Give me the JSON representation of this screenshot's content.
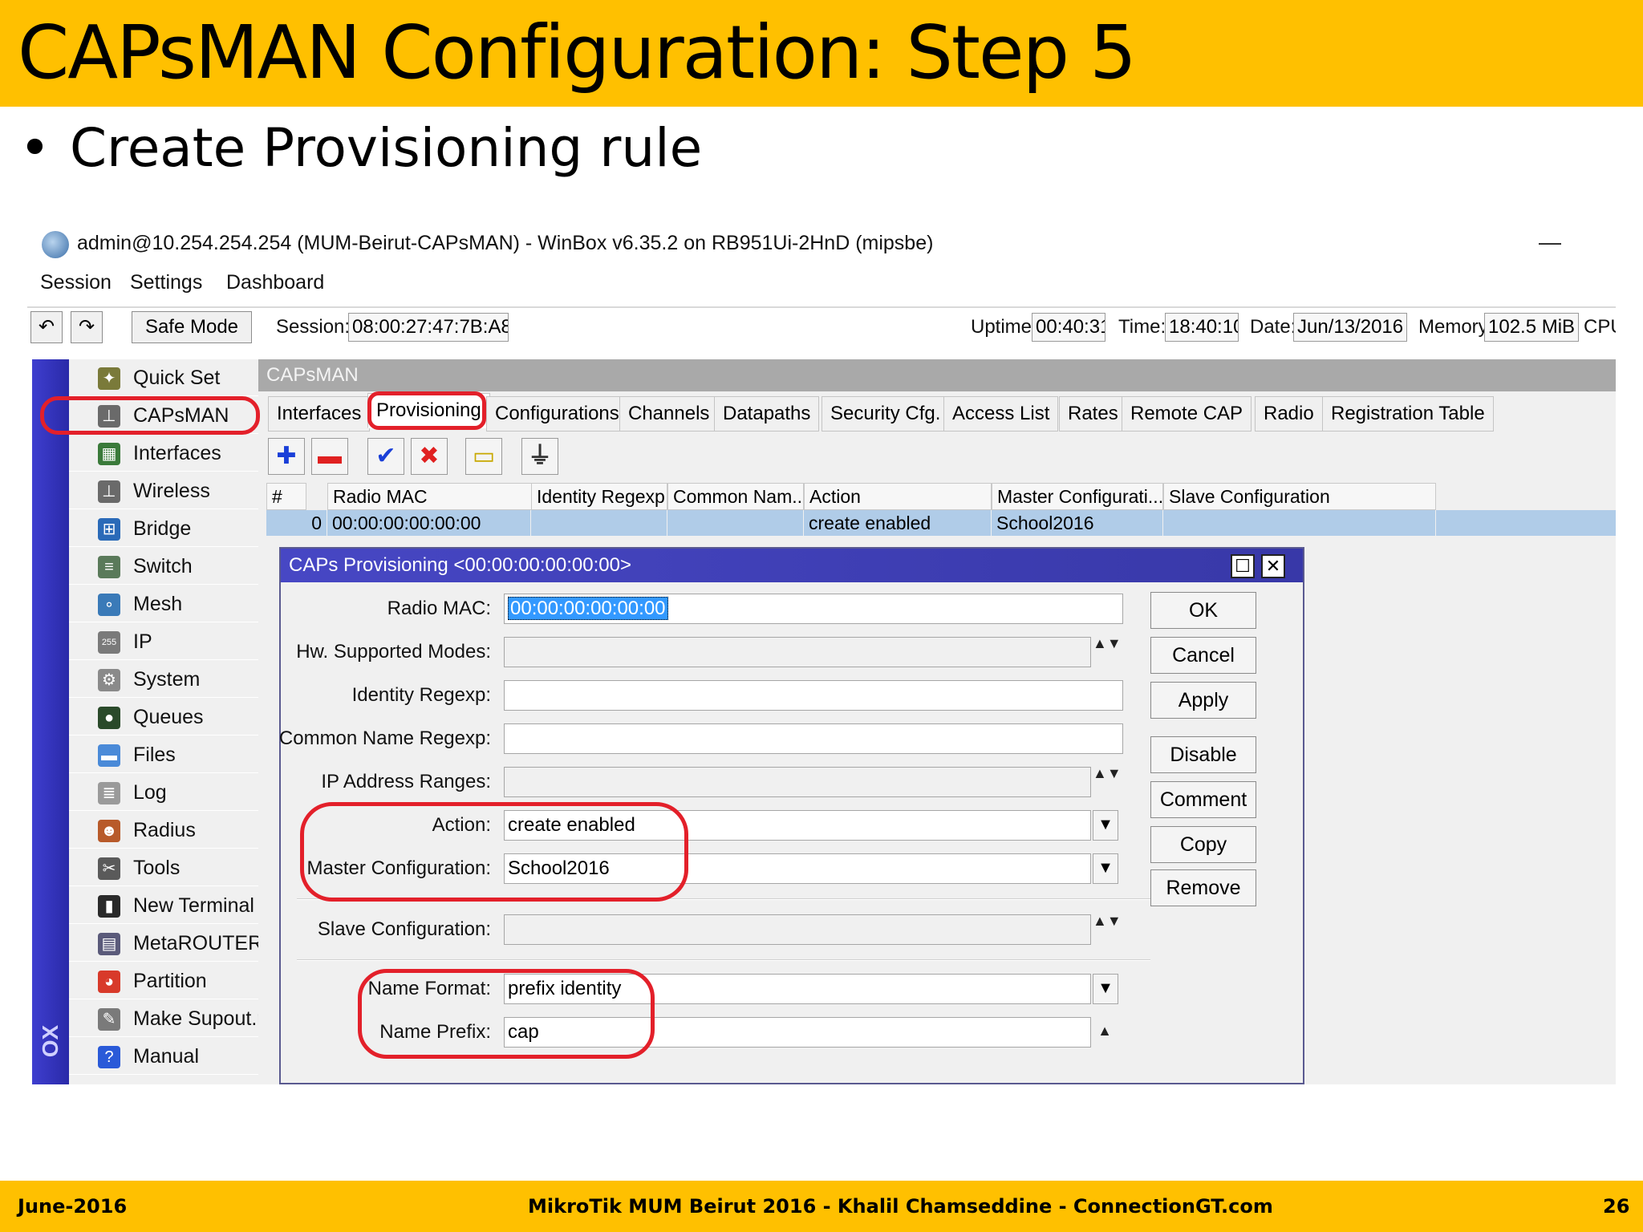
{
  "slide": {
    "title": "CAPsMAN Configuration: Step 5",
    "bullet": "Create Provisioning rule",
    "footer_left": "June-2016",
    "footer_center": "MikroTik MUM Beirut 2016 - Khalil Chamseddine - ConnectionGT.com",
    "footer_right": "26"
  },
  "window": {
    "title": "admin@10.254.254.254 (MUM-Beirut-CAPsMAN) - WinBox v6.35.2 on RB951Ui-2HnD (mipsbe)",
    "minimize": "—",
    "menu": [
      "Session",
      "Settings",
      "Dashboard"
    ],
    "toolbar": {
      "undo_icon": "↶",
      "redo_icon": "↷",
      "safe_mode": "Safe Mode",
      "session_label": "Session:",
      "session_value": "08:00:27:47:7B:A8",
      "uptime_label": "Uptime:",
      "uptime_value": "00:40:31",
      "time_label": "Time:",
      "time_value": "18:40:10",
      "date_label": "Date:",
      "date_value": "Jun/13/2016",
      "memory_label": "Memory:",
      "memory_value": "102.5 MiB",
      "cpu_label": "CPU"
    },
    "strip_text": "OX"
  },
  "sidebar": {
    "items": [
      {
        "label": "Quick Set",
        "icon": "wand-icon",
        "glyph": "✦",
        "color": "#7a7a3a"
      },
      {
        "label": "CAPsMAN",
        "icon": "antenna-icon",
        "glyph": "⊥",
        "color": "#6a6a6a"
      },
      {
        "label": "Interfaces",
        "icon": "interfaces-icon",
        "glyph": "▦",
        "color": "#3a7a3a"
      },
      {
        "label": "Wireless",
        "icon": "wireless-icon",
        "glyph": "⊥",
        "color": "#6a6a6a"
      },
      {
        "label": "Bridge",
        "icon": "bridge-icon",
        "glyph": "⊞",
        "color": "#2a6ab8"
      },
      {
        "label": "Switch",
        "icon": "switch-icon",
        "glyph": "≡",
        "color": "#5a7a5a"
      },
      {
        "label": "Mesh",
        "icon": "mesh-icon",
        "glyph": "∘",
        "color": "#3a7ab8"
      },
      {
        "label": "IP",
        "icon": "ip-icon",
        "glyph": "255",
        "color": "#7a7a7a"
      },
      {
        "label": "System",
        "icon": "gear-icon",
        "glyph": "⚙",
        "color": "#8a8a8a"
      },
      {
        "label": "Queues",
        "icon": "queues-icon",
        "glyph": "●",
        "color": "#2a4a2a"
      },
      {
        "label": "Files",
        "icon": "folder-icon",
        "glyph": "▬",
        "color": "#4a8ad8"
      },
      {
        "label": "Log",
        "icon": "log-icon",
        "glyph": "≣",
        "color": "#9a9a9a"
      },
      {
        "label": "Radius",
        "icon": "users-icon",
        "glyph": "☻",
        "color": "#b85a2a"
      },
      {
        "label": "Tools",
        "icon": "tools-icon",
        "glyph": "✂",
        "color": "#5a5a5a"
      },
      {
        "label": "New Terminal",
        "icon": "terminal-icon",
        "glyph": "▮",
        "color": "#2a2a2a"
      },
      {
        "label": "MetaROUTER",
        "icon": "metarouter-icon",
        "glyph": "▤",
        "color": "#5a5a7a"
      },
      {
        "label": "Partition",
        "icon": "partition-icon",
        "glyph": "◕",
        "color": "#d83a2a"
      },
      {
        "label": "Make Supout.rif",
        "icon": "document-icon",
        "glyph": "✎",
        "color": "#7a7a7a"
      },
      {
        "label": "Manual",
        "icon": "help-icon",
        "glyph": "?",
        "color": "#2a5ad8"
      }
    ]
  },
  "capsman": {
    "header": "CAPsMAN",
    "tabs": [
      "Interfaces",
      "Provisioning",
      "Configurations",
      "Channels",
      "Datapaths",
      "Security Cfg.",
      "Access List",
      "Rates",
      "Remote CAP",
      "Radio",
      "Registration Table"
    ],
    "toolbar_icons": {
      "add": "✚",
      "remove": "▬",
      "enable": "✔",
      "disable": "✖",
      "comment": "▭",
      "filter": "⏚"
    },
    "columns": [
      "#",
      "Radio MAC",
      "Identity Regexp",
      "Common Nam...",
      "Action",
      "Master Configurati...",
      "Slave Configuration"
    ],
    "row": {
      "num": "0",
      "radio_mac": "00:00:00:00:00:00",
      "identity": "",
      "common_name": "",
      "action": "create enabled",
      "master": "School2016",
      "slave": ""
    }
  },
  "dialog": {
    "title": "CAPs Provisioning <00:00:00:00:00:00>",
    "restore_icon": "☐",
    "close_icon": "✕",
    "fields": {
      "radio_mac_label": "Radio MAC:",
      "radio_mac_value": "00:00:00:00:00:00",
      "hw_modes_label": "Hw. Supported Modes:",
      "identity_label": "Identity Regexp:",
      "common_name_label": "Common Name Regexp:",
      "ip_ranges_label": "IP Address Ranges:",
      "action_label": "Action:",
      "action_value": "create enabled",
      "master_label": "Master Configuration:",
      "master_value": "School2016",
      "slave_label": "Slave Configuration:",
      "name_format_label": "Name Format:",
      "name_format_value": "prefix identity",
      "name_prefix_label": "Name Prefix:",
      "name_prefix_value": "cap"
    },
    "updown_icon": "▲▼",
    "dropdown_icon": "▼",
    "up_icon": "▲",
    "buttons": [
      "OK",
      "Cancel",
      "Apply",
      "Disable",
      "Comment",
      "Copy",
      "Remove"
    ]
  },
  "colors": {
    "slide_band": "#FFC000",
    "annotation": "#e3202a",
    "selection": "#b0cce8",
    "dialog_title": "#4747c4"
  }
}
